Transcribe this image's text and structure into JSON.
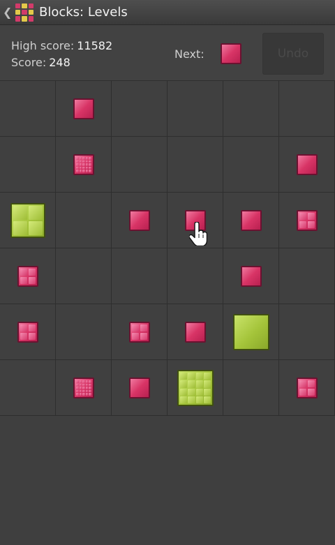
{
  "titlebar": {
    "back_glyph": "❮",
    "title": "Blocks: Levels",
    "icon": "app-grid-icon"
  },
  "status": {
    "high_score_label": "High score:",
    "high_score_value": "11582",
    "score_label": "Score:",
    "score_value": "248",
    "next_label": "Next:",
    "next_block": "pink-1",
    "undo_label": "Undo"
  },
  "board": {
    "rows": 6,
    "cols": 6,
    "blocks": [
      {
        "row": 0,
        "col": 1,
        "color": "pink",
        "size": "small",
        "grid": 1
      },
      {
        "row": 1,
        "col": 1,
        "color": "pink",
        "size": "small",
        "grid": 5
      },
      {
        "row": 1,
        "col": 5,
        "color": "pink",
        "size": "small",
        "grid": 1
      },
      {
        "row": 2,
        "col": 0,
        "color": "green",
        "size": "medium",
        "grid": 2
      },
      {
        "row": 2,
        "col": 2,
        "color": "pink",
        "size": "small",
        "grid": 1
      },
      {
        "row": 2,
        "col": 3,
        "color": "pink",
        "size": "small",
        "grid": 1
      },
      {
        "row": 2,
        "col": 4,
        "color": "pink",
        "size": "small",
        "grid": 1
      },
      {
        "row": 2,
        "col": 5,
        "color": "pink",
        "size": "small",
        "grid": 2
      },
      {
        "row": 3,
        "col": 0,
        "color": "pink",
        "size": "small",
        "grid": 2
      },
      {
        "row": 3,
        "col": 4,
        "color": "pink",
        "size": "small",
        "grid": 1
      },
      {
        "row": 4,
        "col": 0,
        "color": "pink",
        "size": "small",
        "grid": 2
      },
      {
        "row": 4,
        "col": 2,
        "color": "pink",
        "size": "small",
        "grid": 2
      },
      {
        "row": 4,
        "col": 3,
        "color": "pink",
        "size": "small",
        "grid": 1
      },
      {
        "row": 4,
        "col": 4,
        "color": "green",
        "size": "large",
        "grid": 1
      },
      {
        "row": 5,
        "col": 1,
        "color": "pink",
        "size": "small",
        "grid": 5
      },
      {
        "row": 5,
        "col": 2,
        "color": "pink",
        "size": "small",
        "grid": 1
      },
      {
        "row": 5,
        "col": 3,
        "color": "green",
        "size": "large",
        "grid": 4
      },
      {
        "row": 5,
        "col": 5,
        "color": "pink",
        "size": "small",
        "grid": 2
      }
    ]
  },
  "cursor": "hand-pointer-icon",
  "colors": {
    "pink": "#d83466",
    "green": "#a4c43a",
    "background": "#3f3f3f"
  }
}
